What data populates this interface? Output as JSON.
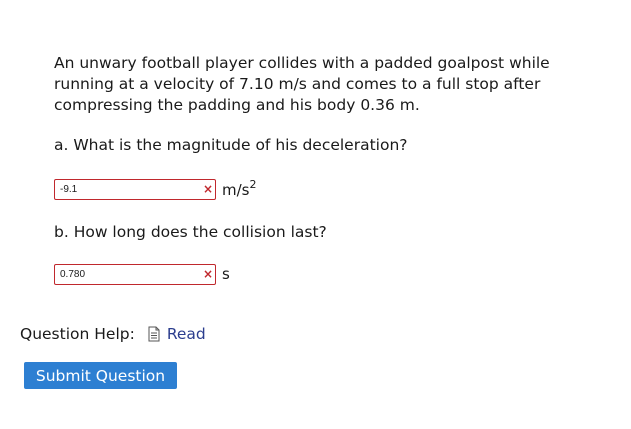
{
  "question": {
    "prompt": "An unwary football player collides with a padded goalpost while running at a velocity of 7.10 m/s and comes to a full stop after compressing the padding and his body 0.36 m.",
    "prompt_lines": [
      "An unwary football player collides with a padded goalpost while",
      "running at a velocity of 7.10 m/s and comes to a full stop after",
      "compressing the padding and his body 0.36 m."
    ],
    "parts": [
      {
        "label": "a. What is the magnitude of his deceleration?",
        "answer_value": "-9.1",
        "status": "incorrect",
        "status_mark": "×",
        "unit_base": "m/s",
        "unit_exp": "2"
      },
      {
        "label": "b. How long does the collision last?",
        "answer_value": "0.780",
        "status": "incorrect",
        "status_mark": "×",
        "unit_base": "s",
        "unit_exp": ""
      }
    ]
  },
  "help": {
    "label": "Question Help:",
    "read_link": "Read",
    "icon": "document-icon"
  },
  "submit": {
    "label": "Submit Question"
  },
  "colors": {
    "incorrect_border": "#c0282d",
    "link": "#2b3d8e",
    "button_bg": "#2d7fd2",
    "button_text": "#ffffff"
  }
}
